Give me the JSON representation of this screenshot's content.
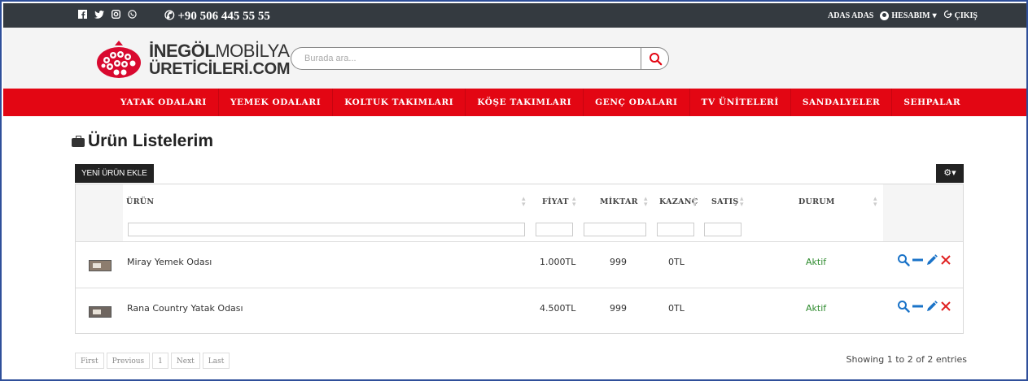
{
  "topbar": {
    "social_icons": [
      "facebook-icon",
      "twitter-icon",
      "instagram-icon",
      "whatsapp-icon"
    ],
    "phone": "+90 506 445 55 55",
    "username": "ADAS ADAS",
    "account_label": "HESABIM",
    "logout_label": "ÇIKIŞ"
  },
  "header": {
    "logo_line1_bold": "İNEGÖL",
    "logo_line1_light": "MOBİLYA",
    "logo_line2": "ÜRETİCİLERİ.COM",
    "search_placeholder": "Burada ara..."
  },
  "nav": {
    "items": [
      "YATAK ODALARI",
      "YEMEK ODALARI",
      "KOLTUK TAKIMLARI",
      "KÖŞE TAKIMLARI",
      "GENÇ ODALARI",
      "TV ÜNİTELERİ",
      "SANDALYELER",
      "SEHPALAR"
    ]
  },
  "page": {
    "title": "Ürün Listelerim",
    "new_button": "YENİ ÜRÜN EKLE",
    "gear_caret": "▾"
  },
  "table": {
    "columns": [
      "ÜRÜN",
      "FİYAT",
      "MİKTAR",
      "KAZANÇ",
      "SATIŞ",
      "DURUM"
    ],
    "rows": [
      {
        "name": "Miray Yemek Odası",
        "price": "1.000TL",
        "qty": "999",
        "earning": "0TL",
        "sales": "",
        "status": "Aktif"
      },
      {
        "name": "Rana Country Yatak Odası",
        "price": "4.500TL",
        "qty": "999",
        "earning": "0TL",
        "sales": "",
        "status": "Aktif"
      }
    ]
  },
  "pagination": {
    "first": "First",
    "previous": "Previous",
    "page": "1",
    "next": "Next",
    "last": "Last",
    "info": "Showing 1 to 2 of 2 entries"
  },
  "colors": {
    "nav_red": "#e30613",
    "topbar": "#343a40",
    "status_green": "#2e8b2e",
    "action_blue": "#1a73c8",
    "delete_red": "#e02020"
  }
}
